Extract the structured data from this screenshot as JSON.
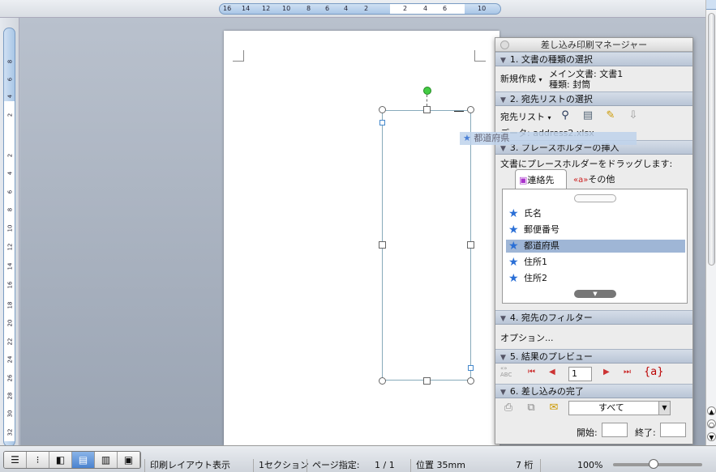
{
  "ruler": {
    "h_ticks": [
      "16",
      "14",
      "12",
      "10",
      "8",
      "6",
      "4",
      "2",
      "2",
      "4",
      "6",
      "10"
    ],
    "v_ticks": [
      "8",
      "6",
      "4",
      "2",
      "2",
      "4",
      "6",
      "8",
      "10",
      "12",
      "14",
      "16",
      "18",
      "20",
      "22",
      "24",
      "26",
      "28",
      "30",
      "32"
    ]
  },
  "canvas": {
    "drag_ghost": "都道府県"
  },
  "palette": {
    "title": "差し込み印刷マネージャー",
    "sections": {
      "doc_type": {
        "header": "1. 文書の種類の選択",
        "new_button": "新規作成",
        "main_doc": "メイン文書: 文書1",
        "doc_kind": "種類: 封筒"
      },
      "recipients": {
        "header": "2. 宛先リストの選択",
        "list_button": "宛先リスト",
        "data_label": "データ: address2.xlsx"
      },
      "placeholders": {
        "header": "3. プレースホルダーの挿入",
        "instruction": "文書にプレースホルダーをドラッグします:",
        "tab_contacts": "連絡先",
        "tab_other": "その他",
        "items": [
          "氏名",
          "郵便番号",
          "都道府県",
          "住所1",
          "住所2"
        ],
        "selected_index": 2
      },
      "filter": {
        "header": "4. 宛先のフィルター",
        "options": "オプション..."
      },
      "preview": {
        "header": "5. 結果のプレビュー",
        "abc_label": "ABC",
        "record": "1",
        "field_code": "{a}"
      },
      "complete": {
        "header": "6. 差し込みの完了",
        "range_value": "すべて",
        "start_label": "開始:",
        "end_label": "終了:"
      }
    }
  },
  "statusbar": {
    "view": "印刷レイアウト表示",
    "section": "1セクション",
    "page_label": "ページ指定:",
    "page_value": "1 / 1",
    "position": "位置 35mm",
    "column": "7 桁",
    "zoom": "100%"
  }
}
